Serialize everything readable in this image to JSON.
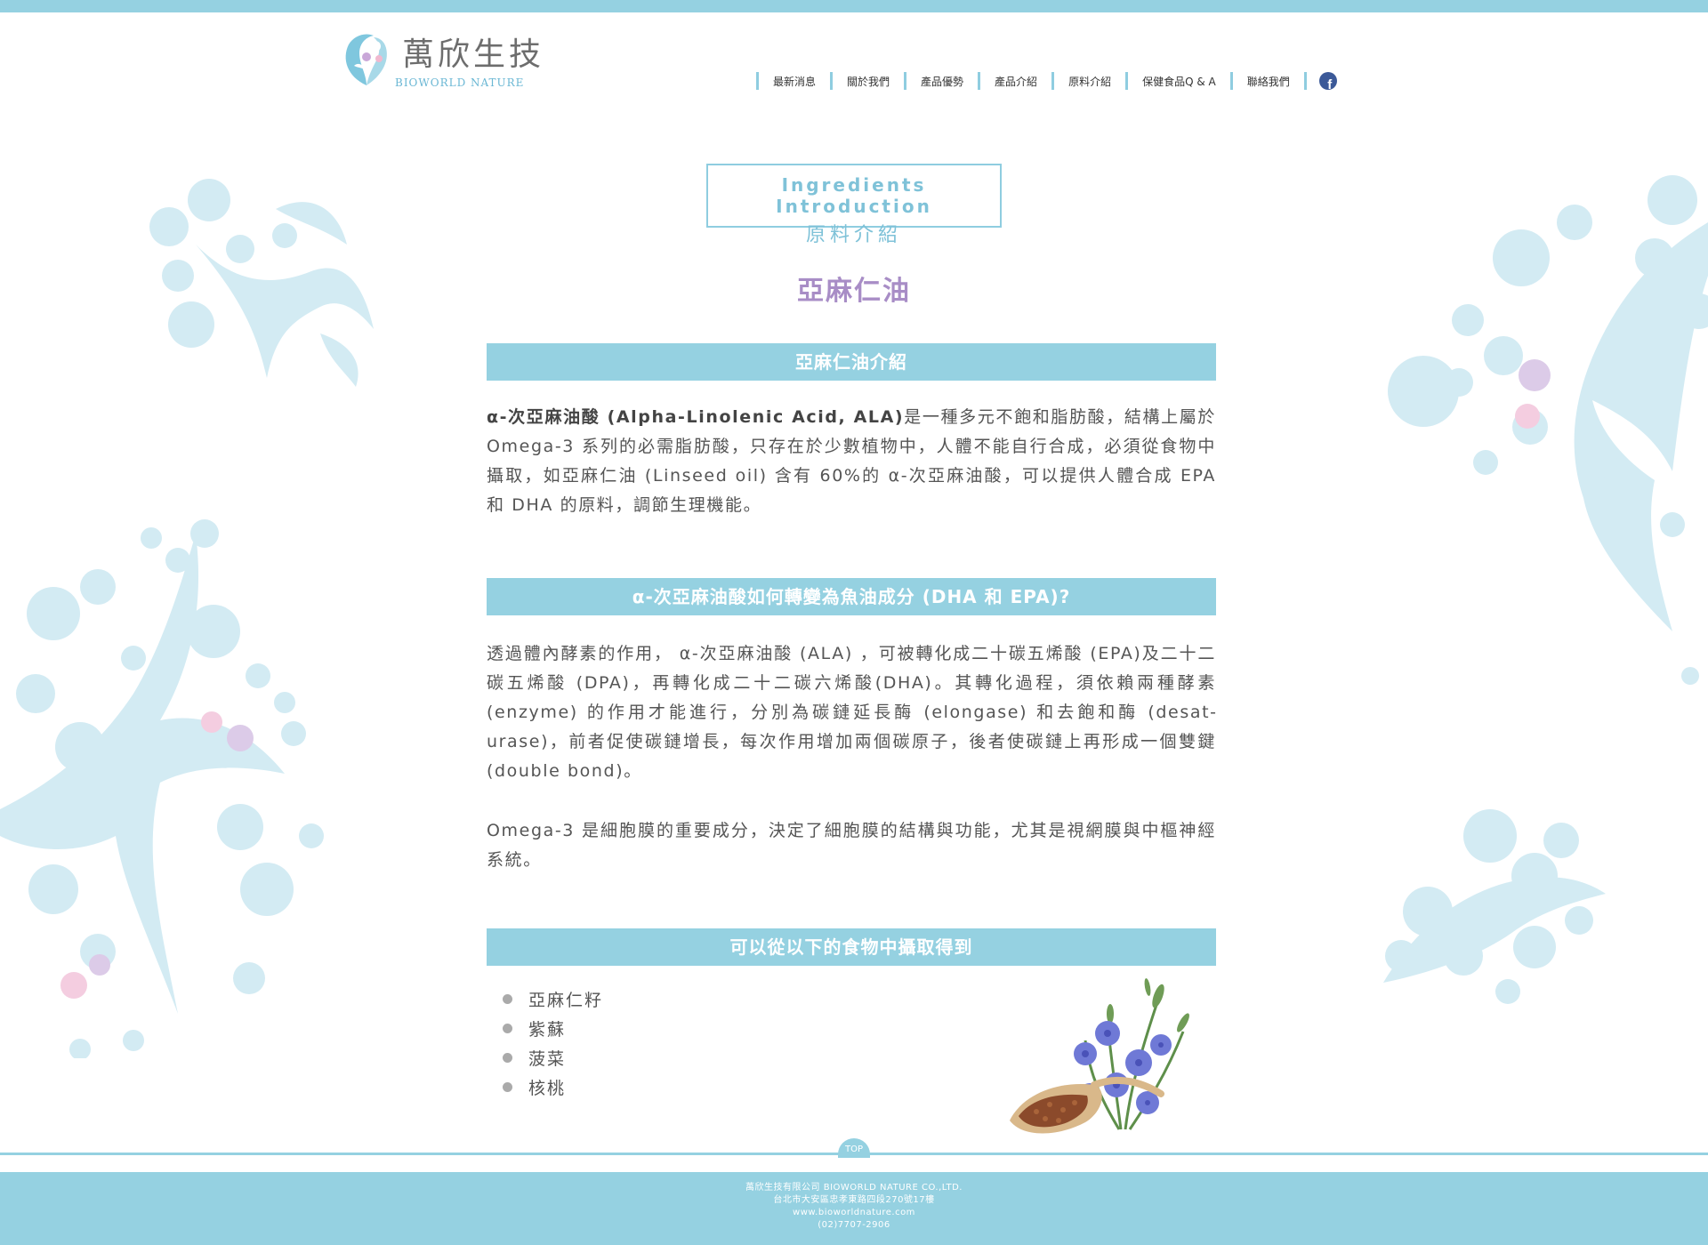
{
  "brand": {
    "name_cn": "萬欣生技",
    "name_en": "BIOWORLD NATURE"
  },
  "nav": {
    "items": [
      "最新消息",
      "關於我們",
      "產品優勢",
      "產品介紹",
      "原料介紹",
      "保健食品Q & A",
      "聯絡我們"
    ],
    "facebook": "f"
  },
  "section_title": {
    "en": "Ingredients Introduction",
    "cn": "原料介紹"
  },
  "page_heading": "亞麻仁油",
  "sections": [
    {
      "heading": "亞麻仁油介紹",
      "para_lead": "α-次亞麻油酸 (Alpha-Linolenic Acid, ALA)",
      "para_rest": "是一種多元不飽和脂肪酸，結構上屬於 Omega-3 系列的必需脂肪酸，只存在於少數植物中，人體不能自行合成，必須從食物中攝取，如亞麻仁油 (Linseed oil) 含有 60%的 α-次亞麻油酸，可以提供人體合成 EPA 和 DHA 的原料，調節生理機能。"
    },
    {
      "heading": "α-次亞麻油酸如何轉變為魚油成分 (DHA 和 EPA)?",
      "para1": "透過體內酵素的作用， α-次亞麻油酸 (ALA) ，可被轉化成二十碳五烯酸 (EPA)及二十二碳五烯酸 (DPA)，再轉化成二十二碳六烯酸(DHA)。其轉化過程，須依賴兩種酵素 (enzyme) 的作用才能進行，分別為碳鏈延長酶 (elongase) 和去飽和酶 (desat­urase)，前者促使碳鏈增長，每次作用增加兩個碳原子，後者使碳鏈上再形成一個雙鍵(double bond)。",
      "para2": "Omega-3 是細胞膜的重要成分，決定了細胞膜的結構與功能，尤其是視網膜與中樞神經系統。"
    },
    {
      "heading": "可以從以下的食物中攝取得到",
      "foods": [
        "亞麻仁籽",
        "紫蘇",
        "菠菜",
        "核桃"
      ]
    }
  ],
  "top_button": "TOP",
  "footer": {
    "company": "萬欣生技有限公司 BIOWORLD NATURE CO.,LTD.",
    "address": "台北市大安區忠孝東路四段270號17樓",
    "website": "www.bioworldnature.com",
    "phone": "(02)7707-2906"
  },
  "colors": {
    "accent": "#95d1e1",
    "heading_purple": "#a88dc6",
    "deco_blue": "#d3ebf3",
    "deco_pink": "#f4cde0",
    "deco_lavender": "#dccbe8",
    "facebook": "#3b5998"
  },
  "icons": [
    "logo-mark-icon",
    "facebook-icon",
    "bullet-dot-icon",
    "flax-flower-image"
  ]
}
